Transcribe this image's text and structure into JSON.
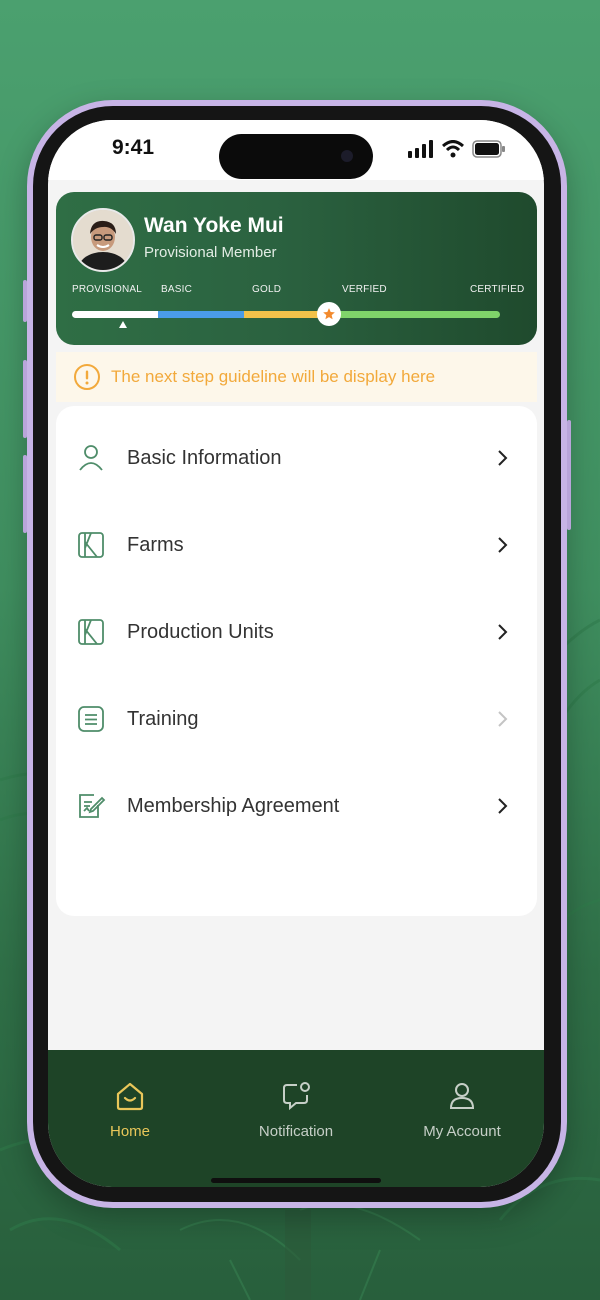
{
  "status_bar": {
    "time": "9:41"
  },
  "profile": {
    "name": "Wan Yoke Mui",
    "role": "Provisional Member",
    "tiers": [
      "PROVISIONAL",
      "BASIC",
      "GOLD",
      "VERFIED",
      "CERTIFIED"
    ],
    "current_tier": "PROVISIONAL",
    "bar_colors": [
      "#ffffff",
      "#4a9ce8",
      "#f2c24a",
      "#7fd46a"
    ]
  },
  "guideline": {
    "text": "The next step guideline will be display here",
    "icon": "info-icon"
  },
  "menu": {
    "items": [
      {
        "label": "Basic Information",
        "icon": "user-icon"
      },
      {
        "label": "Farms",
        "icon": "map-icon"
      },
      {
        "label": "Production Units",
        "icon": "map-icon"
      },
      {
        "label": "Training",
        "icon": "list-icon"
      },
      {
        "label": "Membership Agreement",
        "icon": "agreement-edit-icon"
      }
    ]
  },
  "nav": {
    "items": [
      {
        "label": "Home",
        "icon": "home-icon",
        "active": true
      },
      {
        "label": "Notification",
        "icon": "notification-icon",
        "active": false
      },
      {
        "label": "My Account",
        "icon": "account-icon",
        "active": false
      }
    ],
    "active_color": "#e9c75a",
    "inactive_color": "#c6cfc7"
  },
  "colors": {
    "accent_green": "#2f6e45",
    "icon_green": "#4f8d6a",
    "warning": "#f2a93b"
  }
}
